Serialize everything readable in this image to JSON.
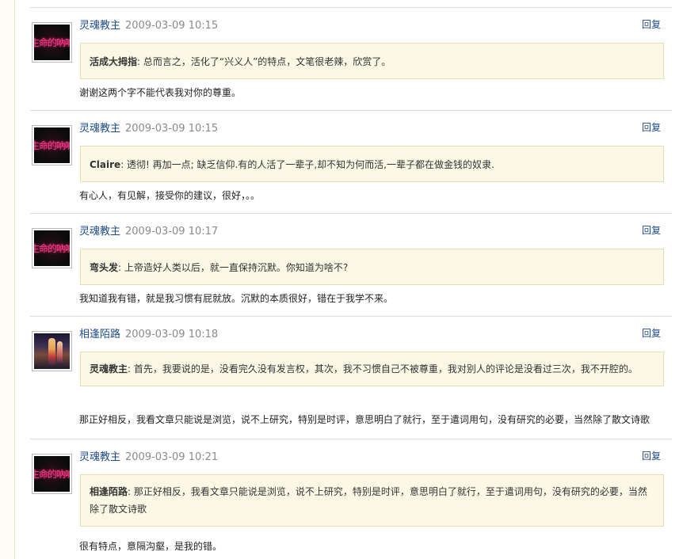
{
  "reply_label": "回复",
  "comments": [
    {
      "author": "灵魂教主",
      "time": "2009-03-09 10:15",
      "avatar": "dark-neon-avatar",
      "avatar_text": "生命的吶喊",
      "quote_name": "活成大拇指",
      "quote_text": ": 总而言之，活化了“兴义人”的特点，文笔很老辣，欣赏了。",
      "body": "谢谢这两个字不能代表我对你的尊重。"
    },
    {
      "author": "灵魂教主",
      "time": "2009-03-09 10:15",
      "avatar": "dark-neon-avatar",
      "avatar_text": "生命的吶喊",
      "quote_name": "Claire",
      "quote_text": ": 透彻! 再加一点; 缺乏信仰.有的人活了一辈子,却不知为何而活,一辈子都在做金钱的奴隶.",
      "body": "有心人，有见解，接受你的建议，很好，。。"
    },
    {
      "author": "灵魂教主",
      "time": "2009-03-09 10:17",
      "avatar": "dark-neon-avatar",
      "avatar_text": "生命的吶喊",
      "quote_name": "弯头发",
      "quote_text": ": 上帝造好人类以后，就一直保持沉默。你知道为啥不?",
      "body": "我知道我有错，就是我习惯有屁就放。沉默的本质很好，错在于我学不来。"
    },
    {
      "author": "相逢陌路",
      "time": "2009-03-09 10:18",
      "avatar": "photo-avatar",
      "avatar_text": "",
      "quote_name": "灵魂教主",
      "quote_text": ": 首先，我要说的是，没看完久没有发言权，其次，我不习惯自己不被尊重，我对别人的评论是没看过三次，我不开腔的。",
      "body": "那正好相反，我看文章只能说是浏览，说不上研究，特别是时评，意思明白了就行，至于遣词用句，没有研究的必要，当然除了散文诗歌"
    },
    {
      "author": "灵魂教主",
      "time": "2009-03-09 10:21",
      "avatar": "dark-neon-avatar",
      "avatar_text": "生命的吶喊",
      "quote_name": "相逢陌路",
      "quote_text": ": 那正好相反，我看文章只能说是浏览，说不上研究，特别是时评，意思明白了就行，至于遣词用句，没有研究的必要，当然除了散文诗歌",
      "body": "很有特点，意隔沟壑，是我的错。"
    }
  ]
}
